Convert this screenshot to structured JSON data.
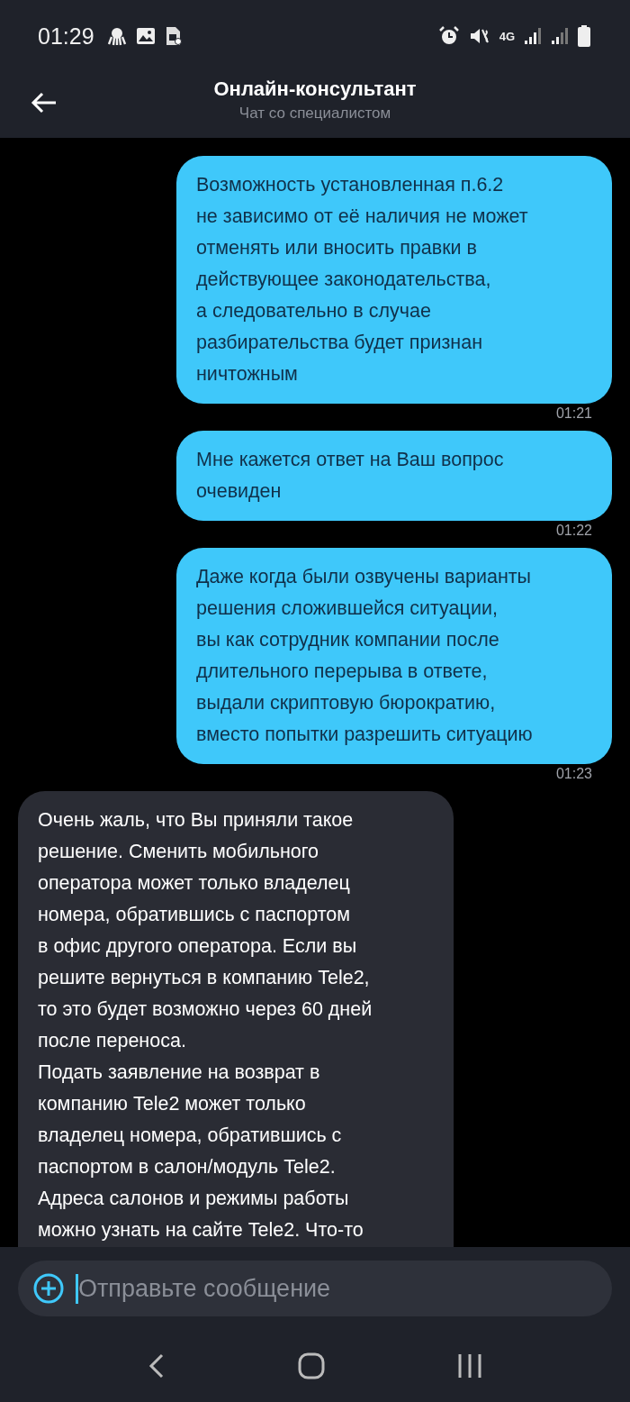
{
  "status_bar": {
    "time": "01:29",
    "network": "4G"
  },
  "header": {
    "title": "Онлайн-консультант",
    "subtitle": "Чат со специалистом"
  },
  "messages": [
    {
      "kind": "outgoing",
      "text": "Возможность установленная п.6.2\nне зависимо от её наличия не может\nотменять или вносить правки в\nдействующее законодательства,\nа следовательно в случае\nразбирательства будет признан\nничтожным",
      "time": "01:21"
    },
    {
      "kind": "outgoing",
      "text": "Мне кажется ответ на Ваш вопрос\nочевиден",
      "time": "01:22"
    },
    {
      "kind": "outgoing",
      "text": "Даже когда были озвучены варианты\nрешения сложившейся ситуации,\nвы как сотрудник компании после\nдлительного перерыва в ответе,\nвыдали скриптовую бюрократию,\nвместо попытки разрешить ситуацию",
      "time": "01:23"
    },
    {
      "kind": "incoming",
      "text": "Очень жаль, что Вы приняли такое\nрешение. Сменить мобильного\nоператора может только владелец\nномера, обратившись с паспортом\nв офис другого оператора. Если вы\nрешите вернуться в компанию Tele2,\nто это будет возможно через 60 дней\nпосле переноса.\nПодать заявление на возврат в\nкомпанию Tele2 может только\nвладелец номера, обратившись с\nпаспортом в салон/модуль Tele2.\nАдреса салонов и режимы работы\nможно узнать на сайте Tele2. Что-то"
    }
  ],
  "composer": {
    "placeholder": "Отправьте сообщение"
  }
}
